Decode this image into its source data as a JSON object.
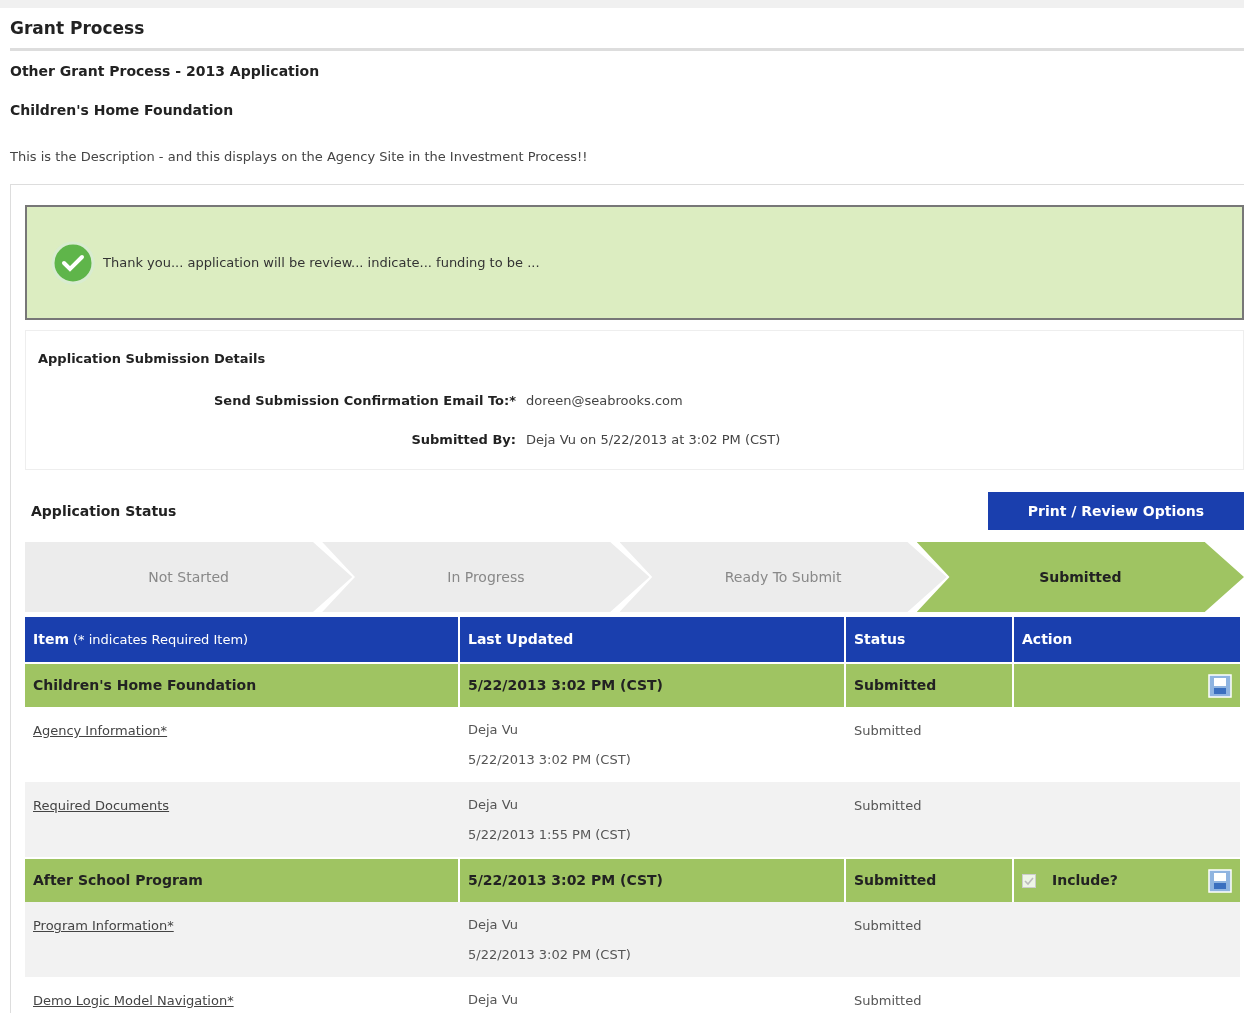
{
  "page_title": "Grant Process",
  "process_name": "Other Grant Process - 2013 Application",
  "organization": "Children's Home Foundation",
  "description": "This is the Description - and this displays on the Agency Site in the Investment Process!!",
  "success_message": "Thank you... application will be review... indicate... funding to be ...",
  "submission_details": {
    "heading": "Application Submission Details",
    "fields": [
      {
        "label": "Send Submission Confirmation Email To:*",
        "value": "doreen@seabrooks.com"
      },
      {
        "label": "Submitted By:",
        "value": "Deja Vu on 5/22/2013 at 3:02 PM (CST)"
      }
    ]
  },
  "application_status": {
    "heading": "Application Status",
    "print_button": "Print / Review Options"
  },
  "steps": [
    {
      "label": "Not Started",
      "selected": false
    },
    {
      "label": "In Progress",
      "selected": false
    },
    {
      "label": "Ready To Submit",
      "selected": false
    },
    {
      "label": "Submitted",
      "selected": true
    }
  ],
  "table": {
    "columns": [
      {
        "label": "Item",
        "note": "(* indicates Required Item)"
      },
      {
        "label": "Last Updated"
      },
      {
        "label": "Status"
      },
      {
        "label": "Action"
      }
    ],
    "rows": [
      {
        "kind": "group",
        "item": "Children's Home Foundation",
        "last_updated": "5/22/2013 3:02 PM (CST)",
        "status": "Submitted"
      },
      {
        "kind": "item",
        "item": "Agency Information*",
        "updated_by": "Deja Vu",
        "updated_at": "5/22/2013 3:02 PM (CST)",
        "status": "Submitted"
      },
      {
        "kind": "item",
        "item": "Required Documents",
        "updated_by": "Deja Vu",
        "updated_at": "5/22/2013 1:55 PM (CST)",
        "status": "Submitted"
      },
      {
        "kind": "group",
        "item": "After School Program",
        "last_updated": "5/22/2013 3:02 PM (CST)",
        "status": "Submitted",
        "include": {
          "label": "Include?",
          "checked": true,
          "disabled": true
        }
      },
      {
        "kind": "item",
        "item": "Program Information*",
        "updated_by": "Deja Vu",
        "updated_at": "5/22/2013 3:02 PM (CST)",
        "status": "Submitted"
      },
      {
        "kind": "item",
        "item": "Demo Logic Model Navigation*",
        "updated_by": "Deja Vu",
        "status": "Submitted"
      }
    ]
  }
}
